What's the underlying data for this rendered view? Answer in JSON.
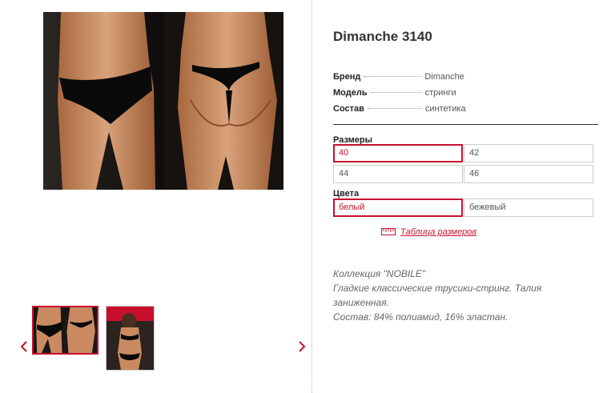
{
  "product": {
    "title": "Dimanche 3140",
    "properties": [
      {
        "label": "Бренд",
        "value": "Dimanche"
      },
      {
        "label": "Модель",
        "value": "стринги"
      },
      {
        "label": "Состав",
        "value": "синтетика"
      }
    ]
  },
  "sizes": {
    "label": "Размеры",
    "options": [
      "40",
      "42",
      "44",
      "46"
    ],
    "selected": "40"
  },
  "colors": {
    "label": "Цвета",
    "options": [
      "белый",
      "бежевый"
    ],
    "selected": "белый"
  },
  "size_table_link": "Таблица размеров",
  "description": [
    "Коллекция \"NOBILE\"",
    "Гладкие классические трусики-стринг. Талия заниженная.",
    "Состав: 84% полиамид, 16% эластан."
  ],
  "gallery": {
    "prev_icon": "chevron-left-icon",
    "next_icon": "chevron-right-icon",
    "thumbnails": 2,
    "active_thumbnail": 1
  },
  "colors_theme": {
    "accent": "#c8102e",
    "photo_bg": "#1a1715",
    "skin": "#c98a62"
  }
}
